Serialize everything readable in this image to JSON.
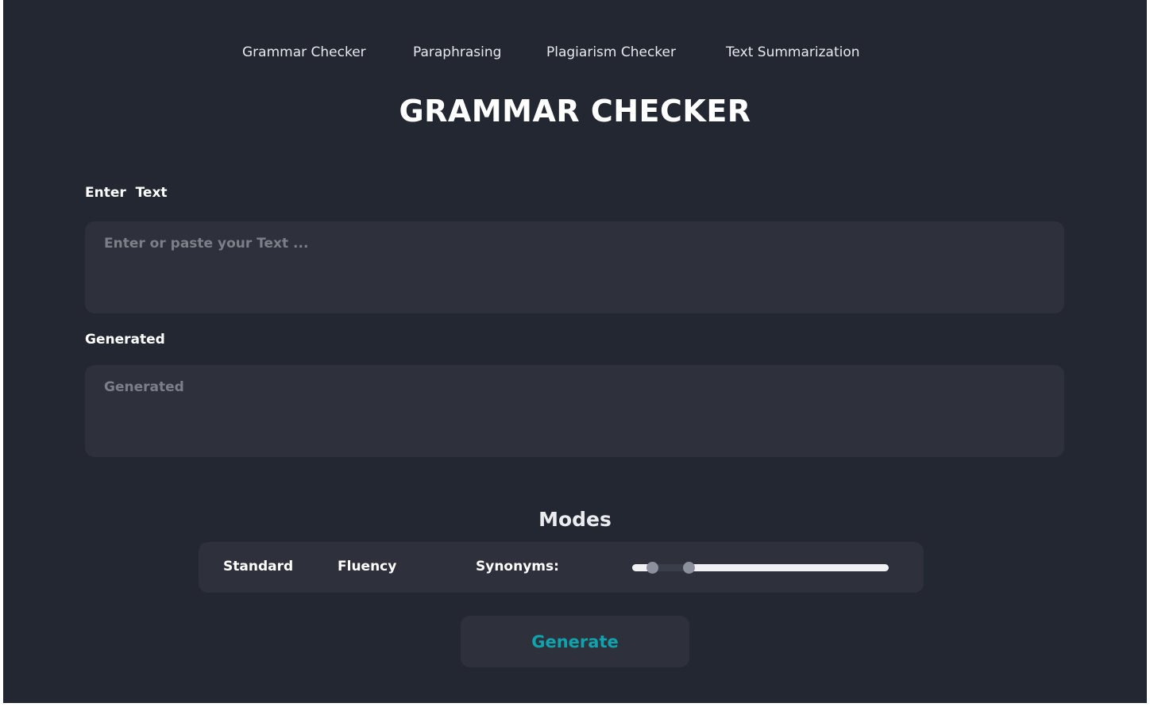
{
  "nav": {
    "items": [
      {
        "label": "Grammar Checker"
      },
      {
        "label": "Paraphrasing"
      },
      {
        "label": "Plagiarism Checker"
      },
      {
        "label": "Text Summarization"
      }
    ]
  },
  "page": {
    "title": "GRAMMAR CHECKER"
  },
  "input_section": {
    "label": "Enter  Text",
    "placeholder": "Enter or paste your Text ...",
    "value": ""
  },
  "output_section": {
    "label": "Generated",
    "placeholder": "Generated",
    "value": ""
  },
  "modes": {
    "heading": "Modes",
    "options": [
      {
        "label": "Standard"
      },
      {
        "label": "Fluency"
      }
    ],
    "synonyms_label": "Synonyms:",
    "synonyms_slider": {
      "low_fraction": 0.08,
      "high_fraction": 0.22
    }
  },
  "actions": {
    "generate_label": "Generate"
  },
  "colors": {
    "background": "#222732",
    "panel": "#2e313c",
    "accent": "#0fa3ae",
    "text": "#ffffff",
    "placeholder": "#7c7f88"
  }
}
